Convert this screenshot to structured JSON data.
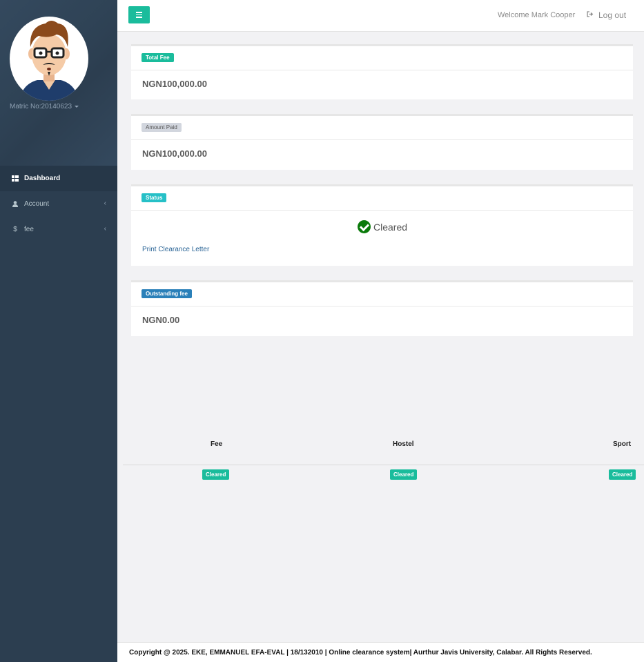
{
  "sidebar": {
    "matric": "Matric No:20140623",
    "menu": [
      {
        "label": "Dashboard",
        "icon": "dashboard-icon",
        "active": true
      },
      {
        "label": "Account",
        "icon": "user-icon"
      },
      {
        "label": "fee",
        "icon": "dollar-icon"
      }
    ]
  },
  "topbar": {
    "welcome": "Welcome Mark Cooper",
    "logout": "Log out"
  },
  "cards": {
    "total_fee": {
      "label": "Total Fee",
      "value": "NGN100,000.00"
    },
    "amount_paid": {
      "label": "Amount Paid",
      "value": "NGN100,000.00"
    },
    "status": {
      "label": "Status",
      "value": "Cleared",
      "link": "Print Clearance Letter"
    },
    "outstanding": {
      "label": "Outstanding fee",
      "value": "NGN0.00"
    }
  },
  "clearance_table": {
    "headers": [
      "Fee",
      "Hostel",
      "Sport"
    ],
    "values": [
      "Cleared",
      "Cleared",
      "Cleared"
    ]
  },
  "footer": {
    "text": "Copyright @ 2025. EKE, EMMANUEL EFA-EVAL | 18/132010 | Online clearance system| Aurthur Javis University, Calabar. All Rights Reserved."
  },
  "colors": {
    "sidebar": "#2c3e50",
    "accent": "#1abc9c",
    "link": "#2a6496"
  }
}
